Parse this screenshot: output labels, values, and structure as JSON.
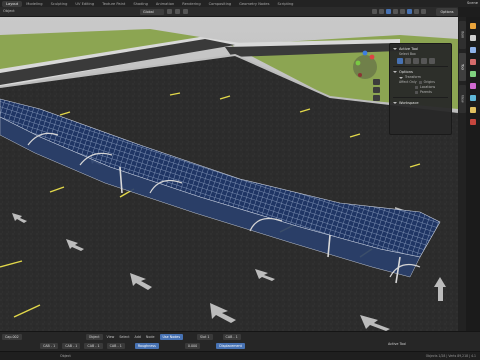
{
  "topbar": {
    "workspaces": [
      "Layout",
      "Modeling",
      "Sculpting",
      "UV Editing",
      "Texture Paint",
      "Shading",
      "Animation",
      "Rendering",
      "Compositing",
      "Geometry Nodes",
      "Scripting"
    ],
    "active_index": 0,
    "scene_label": "Scene"
  },
  "viewport_header": {
    "mode_label": "Object",
    "transform_orientation": "Global",
    "options_label": "Options"
  },
  "npanel": {
    "active_tool_heading": "Active Tool",
    "select_box_label": "Select Box",
    "options_heading": "Options",
    "transform_heading": "Transform",
    "affect_only_label": "Affect Only",
    "origins_label": "Origins",
    "locations_label": "Locations",
    "parents_label": "Parents",
    "workspace_heading": "Workspace"
  },
  "sidetabs": [
    "Item",
    "Tool",
    "View"
  ],
  "properties_icon_colors": [
    "#e8a33b",
    "#cfcfcf",
    "#8fb2e8",
    "#d66c6c",
    "#7fd17f",
    "#d16ad1",
    "#5fb8d8",
    "#e0c060",
    "#c6463e"
  ],
  "bottombar": {
    "row1": {
      "object_name": "Cap.002",
      "menu_object": "Object",
      "menu_view": "View",
      "menu_select": "Select",
      "menu_add": "Add",
      "menu_node": "Node",
      "use_nodes_label": "Use Nodes",
      "slot_label": "Slot 1",
      "material_label": "CAB - 1"
    },
    "row2": {
      "item1": "CAB - 1",
      "item2": "CAB - 1",
      "item3": "CAB - 1",
      "item4": "CAB - 1",
      "roughness_label": "Roughness",
      "roughness_value": "0.000",
      "displacement_label": "Displacement",
      "active_tool_label": "Active Tool"
    }
  },
  "statusbar": {
    "left_text": "Object",
    "right_text": "Objects 1/28 | Verts 89,218 | 4.1"
  },
  "colors": {
    "accent_blue": "#4772b3",
    "ground_dark": "#2b2b2b",
    "grass": "#8ca552",
    "road_line_yellow": "#e2d84a",
    "solar_blue": "#1f3564"
  }
}
